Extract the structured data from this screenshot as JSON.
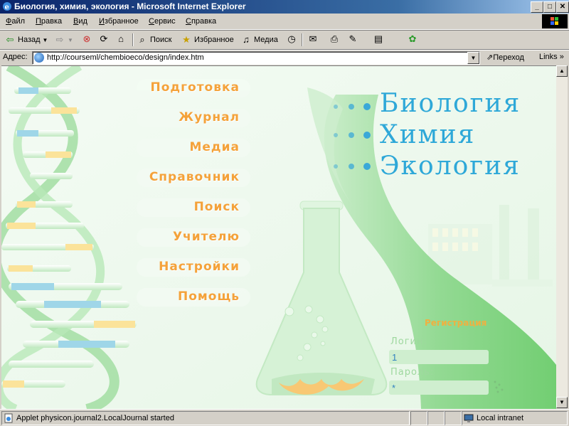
{
  "window": {
    "title": "Биология, химия, экология - Microsoft Internet Explorer",
    "buttons": {
      "minimize": "_",
      "maximize": "□",
      "close": "✕"
    }
  },
  "menu": [
    {
      "hot": "Ф",
      "rest": "айл"
    },
    {
      "hot": "П",
      "rest": "равка"
    },
    {
      "hot": "В",
      "rest": "ид"
    },
    {
      "hot": "И",
      "rest": "збранное"
    },
    {
      "hot": "С",
      "rest": "ервис"
    },
    {
      "hot": "С",
      "rest": "правка"
    }
  ],
  "toolbar": {
    "back_label": "Назад",
    "search_label": "Поиск",
    "favorites_label": "Избранное",
    "media_label": "Медиа"
  },
  "address": {
    "label": "Адрес:",
    "url": "http://courseml/chembioeco/design/index.htm",
    "go_label": "Переход",
    "links_label": "Links"
  },
  "page": {
    "nav": [
      "Подготовка",
      "Журнал",
      "Медиа",
      "Справочник",
      "Поиск",
      "Учителю",
      "Настройки",
      "Помощь"
    ],
    "subjects": [
      "Биология",
      "Химия",
      "Экология"
    ],
    "registration": {
      "title": "Регистрация",
      "login_label": "Логин:",
      "login_value": "1",
      "password_label": "Пароль:",
      "password_value": "*"
    }
  },
  "status": {
    "text": "Applet physicon.journal2.LocalJournal started",
    "zone": "Local intranet"
  },
  "colors": {
    "accent_nav": "#f4a23a",
    "subject_text": "#2ea8d8",
    "title_bar": "#0a246a",
    "page_bg": "#eef9ee",
    "leaf_green": "#7fd07f"
  }
}
